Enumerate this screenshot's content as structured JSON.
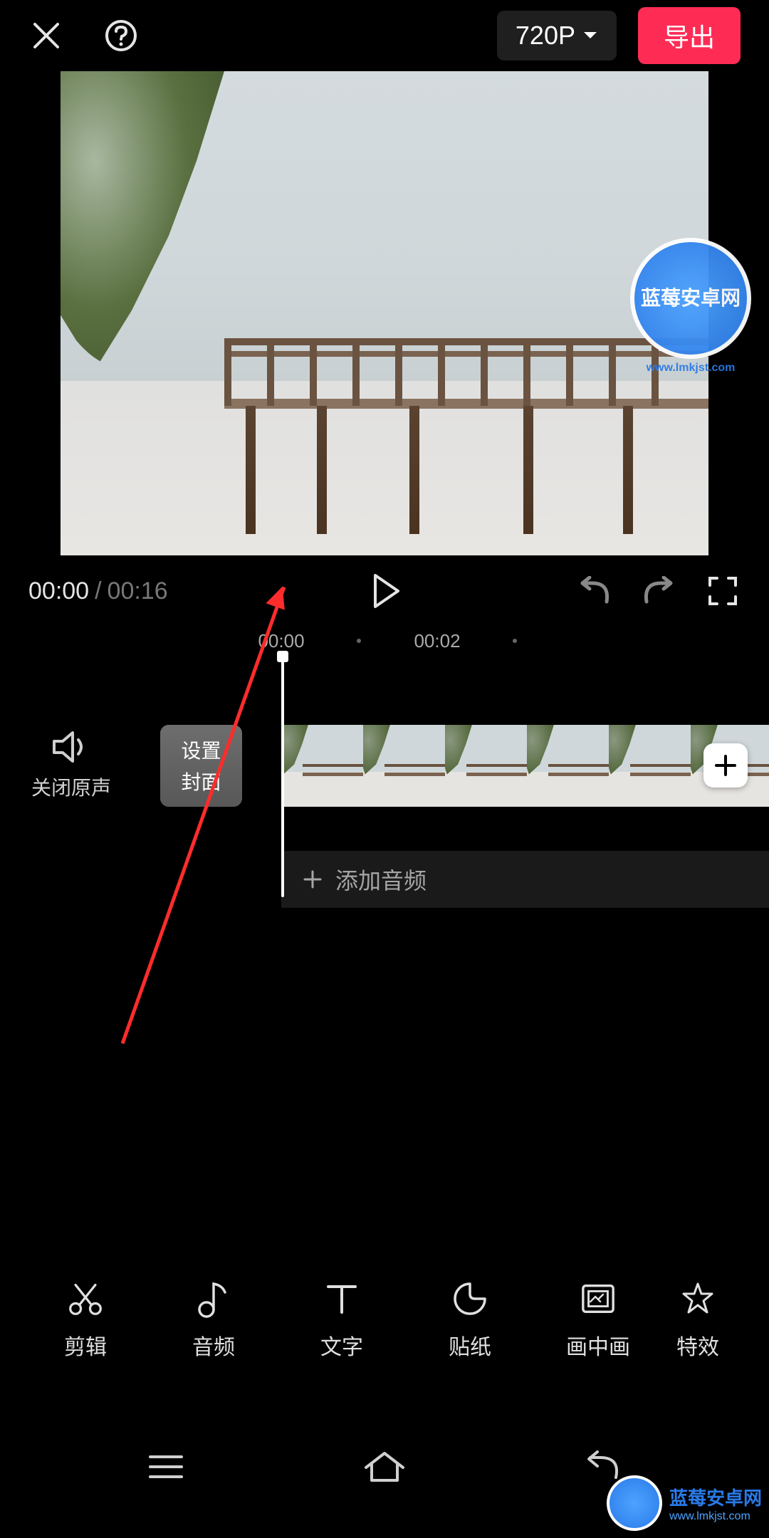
{
  "header": {
    "resolution_label": "720P",
    "export_label": "导出"
  },
  "playback": {
    "current_time": "00:00",
    "separator": "/",
    "total_time": "00:16"
  },
  "ruler": {
    "marks": [
      "00:00",
      "00:02"
    ]
  },
  "tracks": {
    "mute_label": "关闭原声",
    "cover_label_line1": "设置",
    "cover_label_line2": "封面",
    "add_audio_label": "添加音频"
  },
  "toolbar": {
    "items": [
      {
        "label": "剪辑",
        "icon": "scissors-icon"
      },
      {
        "label": "音频",
        "icon": "music-note-icon"
      },
      {
        "label": "文字",
        "icon": "text-icon"
      },
      {
        "label": "贴纸",
        "icon": "sticker-icon"
      },
      {
        "label": "画中画",
        "icon": "pip-icon"
      },
      {
        "label": "特效",
        "icon": "effects-icon"
      }
    ]
  },
  "watermark": {
    "title": "蓝莓安卓网",
    "url": "www.lmkjst.com"
  }
}
